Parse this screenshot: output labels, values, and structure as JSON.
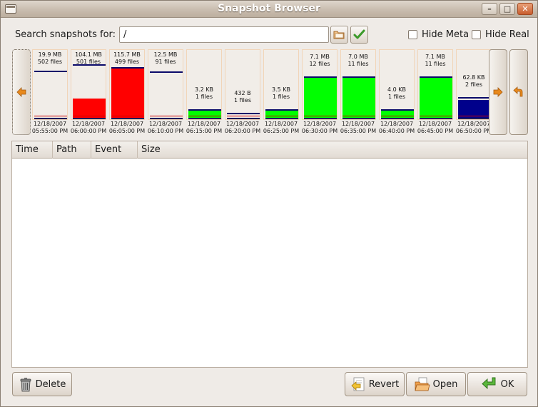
{
  "window": {
    "title": "Snapshot Browser"
  },
  "search": {
    "label": "Search snapshots for:",
    "value": "/"
  },
  "options": {
    "hide_meta": "Hide Meta",
    "hide_real": "Hide Real"
  },
  "snapshots": [
    {
      "size": "19.9 MB",
      "files": "502 files",
      "date": "12/18/2007",
      "time": "05:55:00 PM",
      "fill_color": "#ffffff",
      "fill_level": 0.0,
      "marker_level": 0.78
    },
    {
      "size": "104.1 MB",
      "files": "501 files",
      "date": "12/18/2007",
      "time": "06:00:00 PM",
      "fill_color": "#ff0000",
      "fill_level": 0.32,
      "marker_level": 0.88
    },
    {
      "size": "115.7 MB",
      "files": "499 files",
      "date": "12/18/2007",
      "time": "06:05:00 PM",
      "fill_color": "#ff0000",
      "fill_level": 0.84,
      "marker_level": 0.84
    },
    {
      "size": "12.5 MB",
      "files": "91 files",
      "date": "12/18/2007",
      "time": "06:10:00 PM",
      "fill_color": "#ffffff",
      "fill_level": 0.0,
      "marker_level": 0.76
    },
    {
      "size": "3.2 KB",
      "files": "1 files",
      "date": "12/18/2007",
      "time": "06:15:00 PM",
      "fill_color": "#00ff00",
      "fill_level": 0.12,
      "marker_level": 0.14
    },
    {
      "size": "432 B",
      "files": "1 files",
      "date": "12/18/2007",
      "time": "06:20:00 PM",
      "fill_color": "#ffffff",
      "fill_level": 0.0,
      "marker_level": 0.08
    },
    {
      "size": "3.5 KB",
      "files": "1 files",
      "date": "12/18/2007",
      "time": "06:25:00 PM",
      "fill_color": "#00ff00",
      "fill_level": 0.12,
      "marker_level": 0.14
    },
    {
      "size": "7.1 MB",
      "files": "12 files",
      "date": "12/18/2007",
      "time": "06:30:00 PM",
      "fill_color": "#00ff00",
      "fill_level": 0.66,
      "marker_level": 0.68
    },
    {
      "size": "7.0 MB",
      "files": "11 files",
      "date": "12/18/2007",
      "time": "06:35:00 PM",
      "fill_color": "#00ff00",
      "fill_level": 0.66,
      "marker_level": 0.68
    },
    {
      "size": "4.0 KB",
      "files": "1 files",
      "date": "12/18/2007",
      "time": "06:40:00 PM",
      "fill_color": "#00ff00",
      "fill_level": 0.12,
      "marker_level": 0.14
    },
    {
      "size": "7.1 MB",
      "files": "11 files",
      "date": "12/18/2007",
      "time": "06:45:00 PM",
      "fill_color": "#00ff00",
      "fill_level": 0.66,
      "marker_level": 0.68
    },
    {
      "size": "62.8 KB",
      "files": "2 files",
      "date": "12/18/2007",
      "time": "06:50:00 PM",
      "fill_color": "#00008b",
      "fill_level": 0.3,
      "marker_level": 0.34
    }
  ],
  "table": {
    "columns": [
      "Time",
      "Path",
      "Event",
      "Size"
    ],
    "rows": []
  },
  "buttons": {
    "delete": "Delete",
    "revert": "Revert",
    "open": "Open",
    "ok": "OK"
  },
  "icons": {
    "browse": "folder-icon",
    "apply": "checkmark-icon",
    "prev": "arrow-left-icon",
    "next": "arrow-right-icon",
    "revert_strip": "undo-arrow-icon",
    "delete": "trash-icon",
    "revert": "revert-icon",
    "open": "open-folder-icon",
    "ok": "ok-arrow-icon"
  },
  "colors": {
    "accent_orange": "#e8891c",
    "ok_green": "#3c9a2a",
    "title_bg": "#c9bdaf"
  }
}
